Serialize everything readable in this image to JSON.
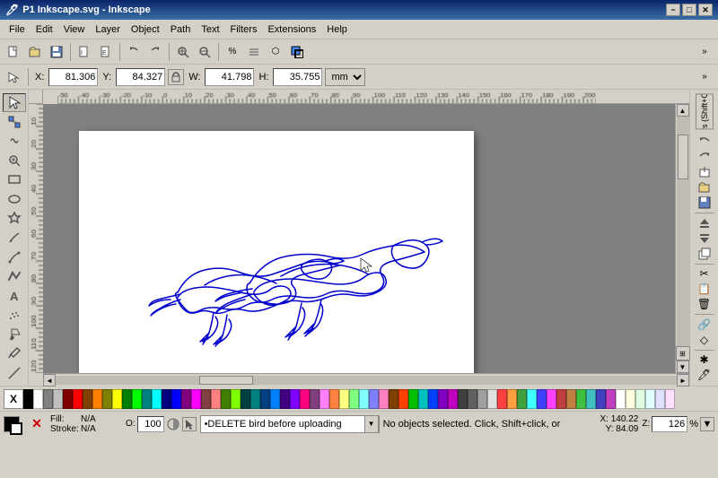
{
  "titlebar": {
    "title": "P1 Inkscape.svg - Inkscape",
    "min_label": "−",
    "max_label": "□",
    "close_label": "✕"
  },
  "menubar": {
    "items": [
      "File",
      "Edit",
      "View",
      "Layer",
      "Object",
      "Path",
      "Text",
      "Filters",
      "Extensions",
      "Help"
    ]
  },
  "toolbar1": {
    "buttons": [
      "new",
      "open",
      "save",
      "print",
      "sep",
      "cut",
      "copy",
      "paste",
      "sep",
      "undo",
      "redo",
      "sep",
      "zoom_in",
      "zoom_out",
      "sep",
      "align",
      "sep",
      "node",
      "fill",
      "stroke"
    ]
  },
  "toolbar2": {
    "x_label": "X",
    "y_label": "Y",
    "w_label": "W",
    "h_label": "H",
    "x_value": "81.306",
    "y_value": "84.327",
    "w_value": "41.798",
    "h_value": "35.755",
    "unit": "mm"
  },
  "left_toolbar": {
    "tools": [
      {
        "name": "selector",
        "icon": "↖",
        "active": false
      },
      {
        "name": "node",
        "icon": "⬡",
        "active": false
      },
      {
        "name": "tweak",
        "icon": "~",
        "active": false
      },
      {
        "name": "zoom",
        "icon": "🔍",
        "active": false
      },
      {
        "name": "rect",
        "icon": "□",
        "active": false
      },
      {
        "name": "circle",
        "icon": "○",
        "active": false
      },
      {
        "name": "star",
        "icon": "★",
        "active": false
      },
      {
        "name": "pencil",
        "icon": "✏",
        "active": false
      },
      {
        "name": "pen",
        "icon": "🖊",
        "active": false
      },
      {
        "name": "callig",
        "icon": "C",
        "active": false
      },
      {
        "name": "text",
        "icon": "A",
        "active": false
      },
      {
        "name": "spray",
        "icon": "S",
        "active": false
      },
      {
        "name": "fill",
        "icon": "⬛",
        "active": false
      },
      {
        "name": "eyedrop",
        "icon": "💧",
        "active": false
      },
      {
        "name": "measure",
        "icon": "📏",
        "active": false
      }
    ]
  },
  "right_panel": {
    "layers_label": "Layers (Shift+Ctrl+L)",
    "buttons": [
      "⭮",
      "⭯",
      "📄",
      "📄",
      "💾",
      "sep",
      "⬆",
      "⬇",
      "📄",
      "sep",
      "🔶",
      "⇄",
      "sep",
      "✂",
      "📋",
      "🗑",
      "sep",
      "🔗",
      "💠",
      "sep",
      "✱",
      "🖊"
    ]
  },
  "palette": {
    "x_label": "X",
    "colors": [
      "#000000",
      "#ffffff",
      "#808080",
      "#c0c0c0",
      "#800000",
      "#ff0000",
      "#804000",
      "#ff8000",
      "#808000",
      "#ffff00",
      "#008000",
      "#00ff00",
      "#008080",
      "#00ffff",
      "#000080",
      "#0000ff",
      "#800080",
      "#ff00ff",
      "#804040",
      "#ff8080",
      "#408000",
      "#80ff00",
      "#004040",
      "#008080",
      "#004080",
      "#0080ff",
      "#400080",
      "#8000ff",
      "#ff0080",
      "#804080",
      "#ff80ff",
      "#ff8040",
      "#ffff80",
      "#80ff80",
      "#80ffff",
      "#8080ff",
      "#ff80c0",
      "#804000",
      "#ff4000",
      "#00c000",
      "#00c0c0",
      "#0040ff",
      "#8000c0",
      "#c000c0",
      "#404040",
      "#606060",
      "#a0a0a0",
      "#e0e0e0",
      "#ff4040",
      "#ffa040",
      "#40a040",
      "#40ffff",
      "#4040ff",
      "#ff40ff",
      "#c04040",
      "#c08040",
      "#40c040",
      "#40c0c0",
      "#4040c0",
      "#c040c0",
      "#ffffff",
      "#ffffe0",
      "#e0ffe0",
      "#e0ffff",
      "#e0e0ff",
      "#ffe0ff"
    ]
  },
  "statusbar": {
    "fill_label": "Fill:",
    "fill_value": "N/A",
    "stroke_label": "Stroke:",
    "stroke_value": "N/A",
    "opacity_label": "O:",
    "opacity_value": "100",
    "layer_value": "•DELETE bird before uploading",
    "status_message": "No objects selected. Click, Shift+click, or d",
    "x_coord": "X: 140.22",
    "y_coord": "Y:  84.09",
    "zoom_value": "126",
    "zoom_unit": "%"
  }
}
